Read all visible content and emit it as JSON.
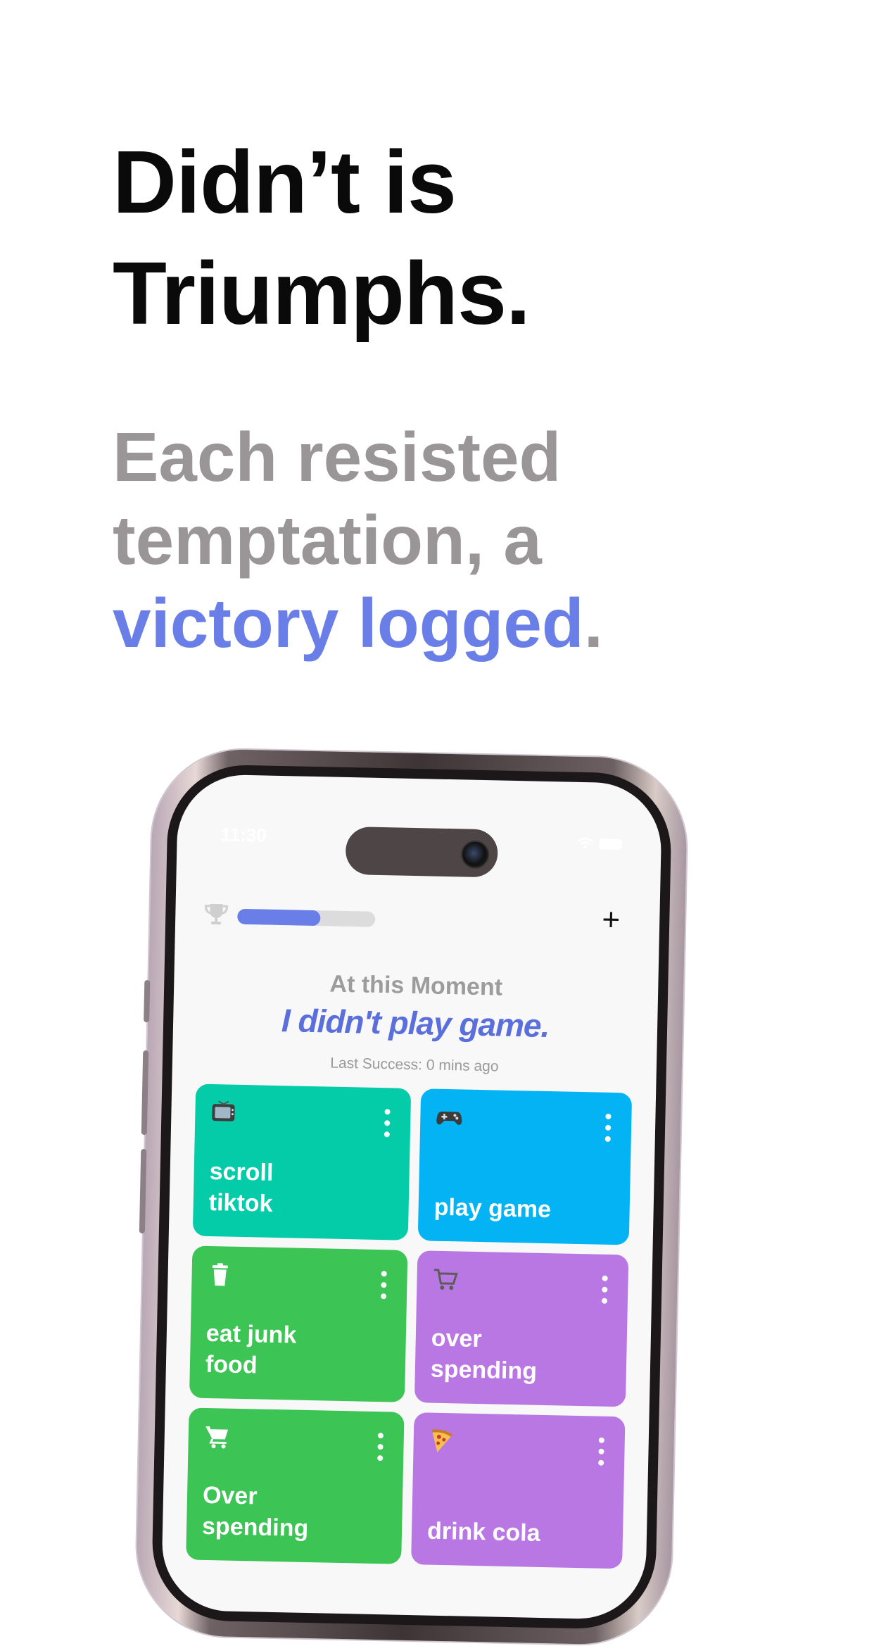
{
  "headline": {
    "line1": "Didn’t is",
    "line2": "Triumphs."
  },
  "subheadline": {
    "line1": "Each resisted",
    "line2": "temptation, a",
    "accent": "victory logged",
    "punct": "."
  },
  "colors": {
    "accent": "#6a7ee8",
    "teal": "#05cca8",
    "sky": "#03b3f3",
    "green": "#3cc455",
    "purple": "#b877e2"
  },
  "phone": {
    "status": {
      "time": "11:30"
    },
    "progress": {
      "fraction": 0.6
    },
    "moment": {
      "label": "At this Moment",
      "title": "I didn't play game.",
      "last_success": "Last Success: 0 mins ago"
    },
    "cards": [
      {
        "label": "scroll\ntiktok",
        "icon": "tv-icon",
        "color": "#05cca8"
      },
      {
        "label": "play game",
        "icon": "game-controller-icon",
        "color": "#03b3f3"
      },
      {
        "label": "eat junk\nfood",
        "icon": "trash-icon",
        "color": "#3cc455"
      },
      {
        "label": "over\nspending",
        "icon": "shopping-cart-icon",
        "color": "#b877e2"
      },
      {
        "label": "Over\nspending",
        "icon": "shopping-cart-icon",
        "color": "#3cc455"
      },
      {
        "label": "drink cola",
        "icon": "pizza-icon",
        "color": "#b877e2"
      }
    ]
  }
}
